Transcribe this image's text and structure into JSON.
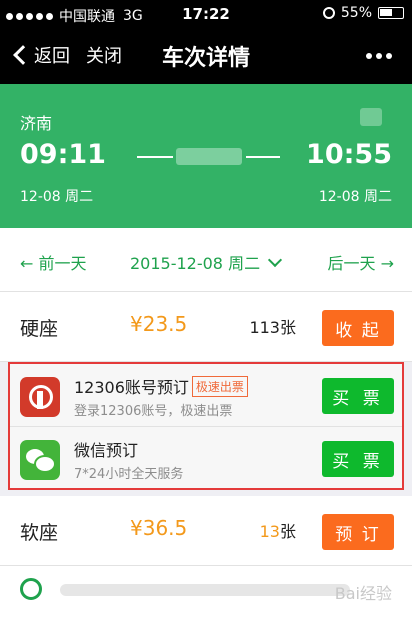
{
  "status": {
    "carrier": "中国联通",
    "network": "3G",
    "time": "17:22",
    "battery": "55%"
  },
  "nav": {
    "back": "返回",
    "close": "关闭",
    "title": "车次详情"
  },
  "train": {
    "from": "济南",
    "departure_time": "09:11",
    "arrival_time": "10:55",
    "departure_date": "12-08  周二",
    "arrival_date": "12-08  周二"
  },
  "datebar": {
    "prev": "前一天",
    "current": "2015-12-08 周二",
    "next": "后一天"
  },
  "seats": [
    {
      "name": "硬座",
      "price": "¥23.5",
      "count": "113",
      "unit": "张",
      "action": "收 起"
    },
    {
      "name": "软座",
      "price": "¥36.5",
      "count": "13",
      "unit": "张",
      "action": "预 订"
    }
  ],
  "options": [
    {
      "title": "12306账号预订",
      "badge": "极速出票",
      "subtitle": "登录12306账号，极速出票",
      "action": "买 票",
      "icon": "railway-icon"
    },
    {
      "title": "微信预订",
      "subtitle": "7*24小时全天服务",
      "action": "买 票",
      "icon": "wechat-icon"
    }
  ],
  "watermark": "Bai经验",
  "colors": {
    "green": "#33b266",
    "orange": "#fb6b1e",
    "buy_green": "#0eb92d",
    "highlight": "#e43a3a"
  }
}
